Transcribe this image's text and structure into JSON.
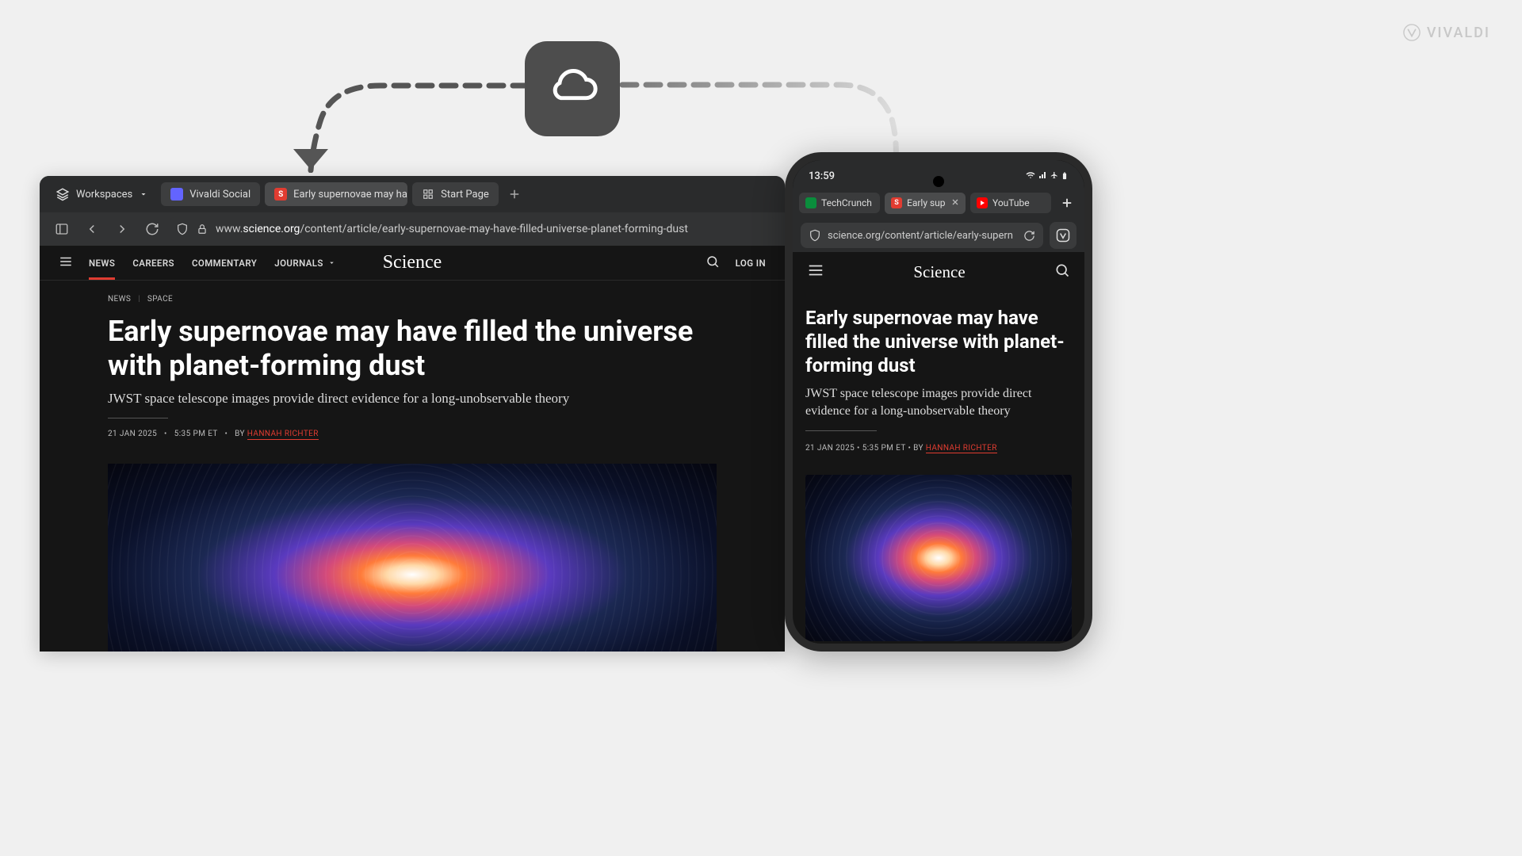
{
  "brand": "VIVALDI",
  "desktop": {
    "workspaces_label": "Workspaces",
    "tabs": [
      {
        "label": "Vivaldi Social",
        "favicon": "mastodon"
      },
      {
        "label": "Early supernovae may hav",
        "favicon": "science",
        "active": true
      },
      {
        "label": "Start Page",
        "favicon": "grid"
      }
    ],
    "url_prefix": "www.",
    "url_domain": "science.org",
    "url_path": "/content/article/early-supernovae-may-have-filled-universe-planet-forming-dust"
  },
  "site": {
    "logo": "Science",
    "nav": [
      "NEWS",
      "CAREERS",
      "COMMENTARY",
      "JOURNALS"
    ],
    "login": "LOG IN",
    "breadcrumb": [
      "NEWS",
      "SPACE"
    ],
    "headline": "Early supernovae may have filled the universe with planet-forming dust",
    "subhead": "JWST space telescope images provide direct evidence for a long-unobservable theory",
    "date": "21 JAN 2025",
    "time": "5:35 PM ET",
    "by_label": "BY",
    "author": "HANNAH RICHTER"
  },
  "mobile": {
    "clock": "13:59",
    "tabs": [
      {
        "label": "TechCrunch",
        "favicon": "tc"
      },
      {
        "label": "Early sup",
        "favicon": "science",
        "active": true,
        "closeable": true
      },
      {
        "label": "YouTube",
        "favicon": "yt"
      }
    ],
    "url": "science.org/content/article/early-supern"
  }
}
